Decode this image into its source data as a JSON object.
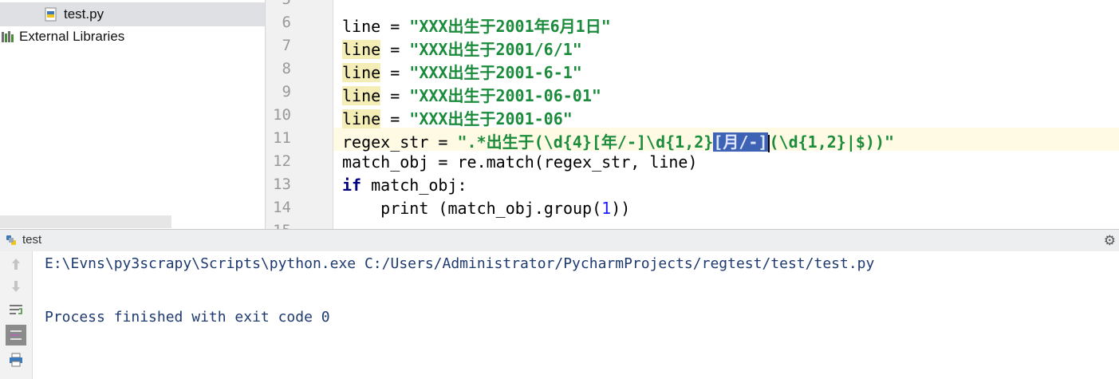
{
  "project": {
    "items": [
      {
        "label": "test.py",
        "icon": "python-file-icon",
        "selected": true
      },
      {
        "label": "External Libraries",
        "icon": "library-icon",
        "selected": false
      }
    ]
  },
  "editor": {
    "line_numbers": [
      "5",
      "6",
      "7",
      "8",
      "9",
      "10",
      "11",
      "12",
      "13",
      "14",
      "15"
    ],
    "lines": {
      "l6": {
        "var": "line",
        "op": " = ",
        "str": "\"XXX出生于2001年6月1日\""
      },
      "l7": {
        "var": "line",
        "op": " = ",
        "str": "\"XXX出生于2001/6/1\""
      },
      "l8": {
        "var": "line",
        "op": " = ",
        "str": "\"XXX出生于2001-6-1\""
      },
      "l9": {
        "var": "line",
        "op": " = ",
        "str": "\"XXX出生于2001-06-01\""
      },
      "l10": {
        "var": "line",
        "op": " = ",
        "str": "\"XXX出生于2001-06\""
      },
      "l11": {
        "var": "regex_str",
        "op": " = ",
        "str_a": "\".*出生于(\\d{4}[年/-]\\d{1,2}",
        "str_sel": "[月/-]",
        "str_b": "(\\d{1,2}|$))\""
      },
      "l12": {
        "text_a": "match_obj = re.match(regex_str, line)"
      },
      "l13": {
        "kw": "if",
        "text": " match_obj:"
      },
      "l14": {
        "indent": "    ",
        "func": "print",
        "text_a": " (match_obj.group(",
        "num": "1",
        "text_b": "))"
      }
    }
  },
  "run": {
    "tab_label": "test",
    "console": [
      "E:\\Evns\\py3scrapy\\Scripts\\python.exe C:/Users/Administrator/PycharmProjects/regtest/test/test.py",
      "Process finished with exit code 0"
    ]
  },
  "colors": {
    "keyword": "#000080",
    "string": "#1b8c3c",
    "number": "#1a1aff",
    "selection": "#3f63b4",
    "caret_row": "#fffae3",
    "console_text": "#1e3a6e"
  }
}
